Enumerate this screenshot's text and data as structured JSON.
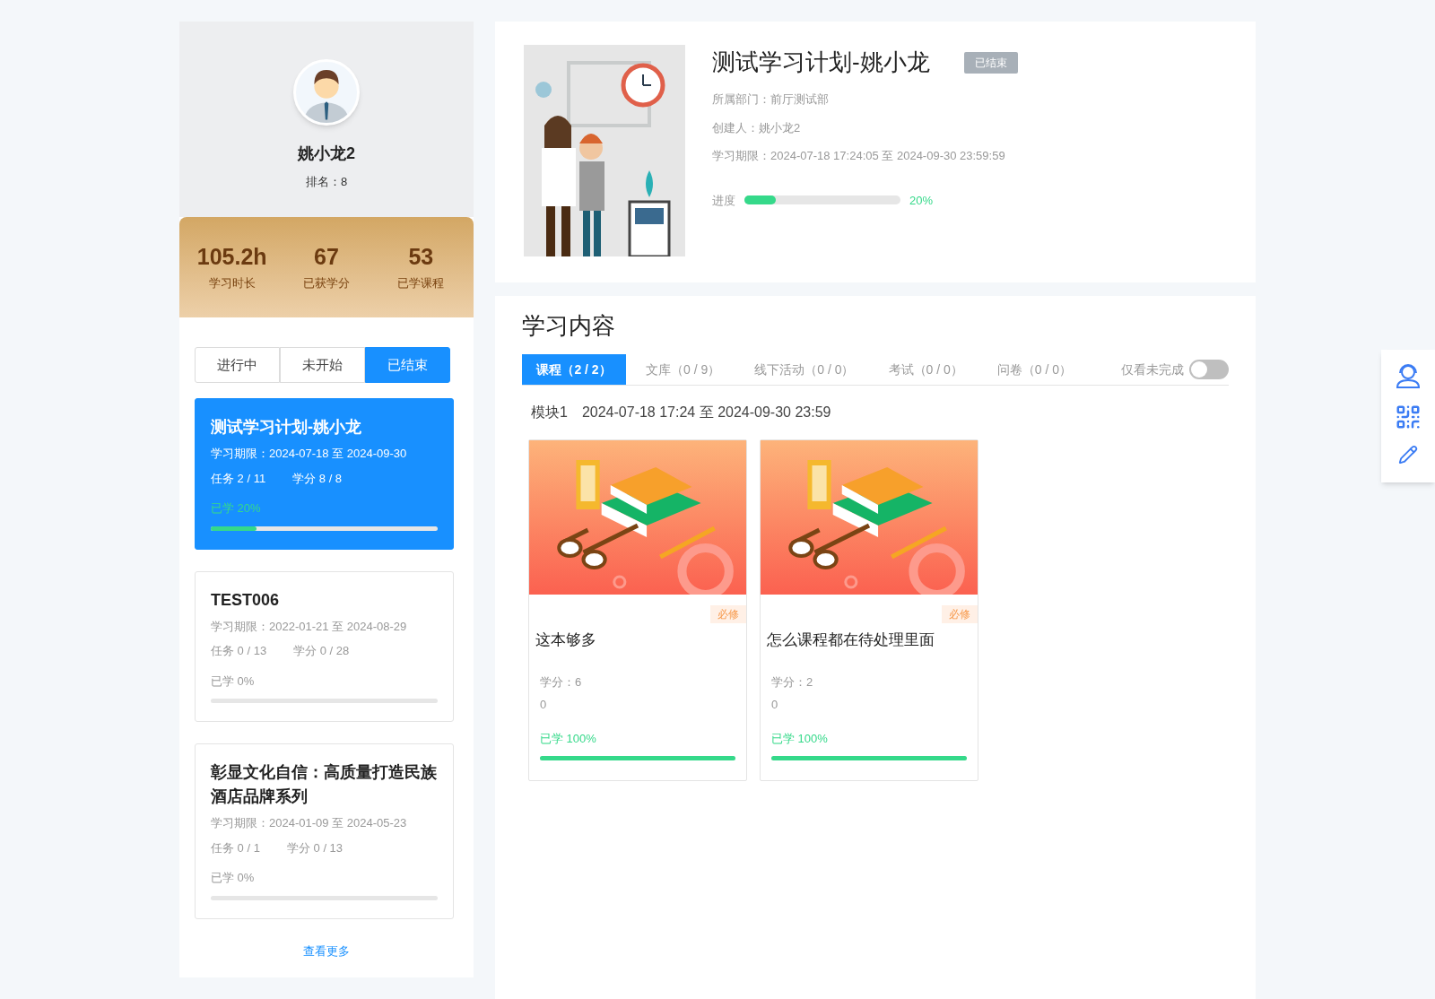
{
  "profile": {
    "name": "姚小龙2",
    "rank": "排名：8"
  },
  "stats": [
    {
      "value": "105.2h",
      "label": "学习时长"
    },
    {
      "value": "67",
      "label": "已获学分"
    },
    {
      "value": "53",
      "label": "已学课程"
    }
  ],
  "status_tabs": [
    {
      "label": "进行中",
      "selected": false
    },
    {
      "label": "未开始",
      "selected": false
    },
    {
      "label": "已结束",
      "selected": true
    }
  ],
  "plans": [
    {
      "title": "测试学习计划-姚小龙",
      "period": "学习期限：2024-07-18 至 2024-09-30",
      "tasks": "任务 2 / 11",
      "credits": "学分 8 / 8",
      "progress_text": "已学 20%",
      "level": 0.2,
      "selected": true
    },
    {
      "title": "TEST006",
      "period": "学习期限：2022-01-21 至 2024-08-29",
      "tasks": "任务 0 / 13",
      "credits": "学分 0 / 28",
      "progress_text": "已学 0%",
      "level": 0,
      "selected": false
    },
    {
      "title": "彰显文化自信：高质量打造民族酒店品牌系列",
      "period": "学习期限：2024-01-09 至 2024-05-23",
      "tasks": "任务 0 / 1",
      "credits": "学分 0 / 13",
      "progress_text": "已学 0%",
      "level": 0,
      "selected": false
    }
  ],
  "more_link": "查看更多",
  "plan": {
    "title": "测试学习计划-姚小龙",
    "status_badge": "已结束",
    "department": "所属部门：前厅测试部",
    "creator": "创建人：姚小龙2",
    "period": "学习期限：2024-07-18 17:24:05 至 2024-09-30 23:59:59",
    "progress_label": "进度",
    "level": 0.2,
    "progress_text": "20%"
  },
  "content": {
    "heading": "学习内容",
    "tabs": [
      {
        "label": "课程（2 / 2）",
        "selected": true
      },
      {
        "label": "文库（0 / 9）",
        "selected": false
      },
      {
        "label": "线下活动（0 / 0）",
        "selected": false
      },
      {
        "label": "考试（0 / 0）",
        "selected": false
      },
      {
        "label": "问卷（0 / 0）",
        "selected": false
      }
    ],
    "toggle": {
      "label": "仅看未完成",
      "on": false
    },
    "module": {
      "name": "模块1",
      "range": "2024-07-18 17:24 至 2024-09-30 23:59"
    },
    "courses": [
      {
        "badge": "必修",
        "title": "这本够多",
        "credit": "学分：6",
        "extra": "0",
        "progress_text": "已学 100%",
        "level": 1
      },
      {
        "badge": "必修",
        "title": "怎么课程都在待处理里面",
        "credit": "学分：2",
        "extra": "0",
        "progress_text": "已学 100%",
        "level": 1
      }
    ]
  }
}
